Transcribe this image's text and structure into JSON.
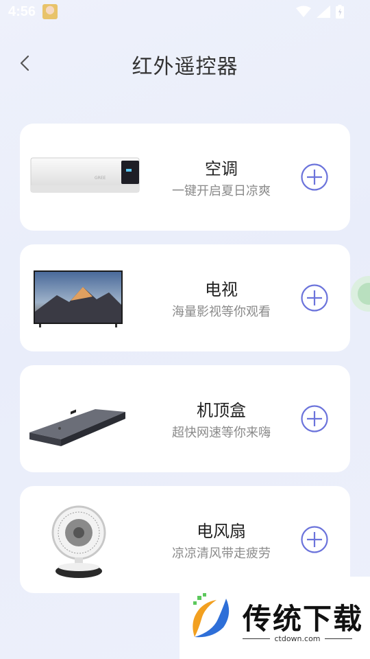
{
  "status_bar": {
    "time": "4:56"
  },
  "header": {
    "title": "红外遥控器"
  },
  "devices": [
    {
      "name": "空调",
      "desc": "一键开启夏日凉爽",
      "icon": "air-conditioner-image"
    },
    {
      "name": "电视",
      "desc": "海量影视等你观看",
      "icon": "tv-image"
    },
    {
      "name": "机顶盒",
      "desc": "超快网速等你来嗨",
      "icon": "set-top-box-image"
    },
    {
      "name": "电风扇",
      "desc": "凉凉清风带走疲劳",
      "icon": "fan-image"
    }
  ],
  "watermark": {
    "brand": "传统下载",
    "url": "ctdown.com"
  },
  "colors": {
    "accent": "#6b73db",
    "background": "#eef1fb"
  }
}
